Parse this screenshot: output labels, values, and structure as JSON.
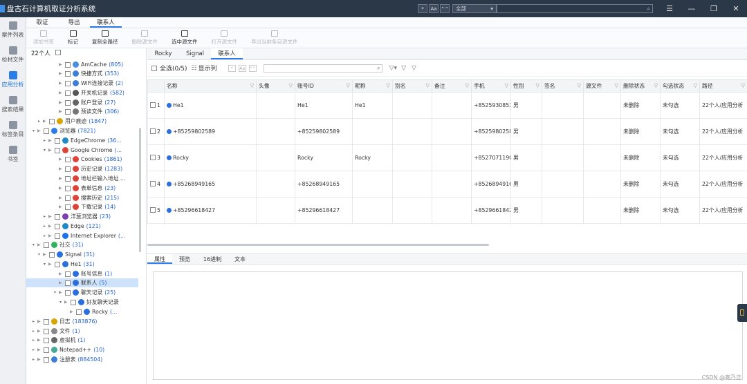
{
  "app": {
    "title": "盘古石计算机取证分析系统"
  },
  "titlebar": {
    "btn1": "*",
    "btn2": "Aa",
    "btn3": "\" \"",
    "scope": "全部",
    "scope_arrow": "▾",
    "search_icon": "⌕",
    "menu": "☰",
    "min": "—",
    "max": "❐",
    "close": "✕"
  },
  "leftnav": [
    {
      "label": "案件列表"
    },
    {
      "label": "检材文件"
    },
    {
      "label": "应用分析"
    },
    {
      "label": "搜索结果"
    },
    {
      "label": "标签条目"
    },
    {
      "label": "书签"
    }
  ],
  "toptabs": [
    "取证",
    "导出",
    "联系人"
  ],
  "toolbar": [
    "添加书签",
    "标记",
    "复制全路径",
    "删除源文件",
    "选中源文件",
    "打开源文件",
    "导出当前条目源文件"
  ],
  "tree": {
    "header": "22个人",
    "rows": [
      {
        "label": "AmCache",
        "count": "(805)"
      },
      {
        "label": "快捷方式",
        "count": "(353)"
      },
      {
        "label": "WiFi连接记录",
        "count": "(2)"
      },
      {
        "label": "开关机记录",
        "count": "(582)"
      },
      {
        "label": "账户登录",
        "count": "(27)"
      },
      {
        "label": "预读文件",
        "count": "(306)"
      },
      {
        "label": "用户痕迹",
        "count": "(1847)"
      },
      {
        "label": "浏览器",
        "count": "(7821)"
      },
      {
        "label": "EdgeChrome",
        "count": "(36..."
      },
      {
        "label": "Google Chrome",
        "count": "(..."
      },
      {
        "label": "Cookies",
        "count": "(1861)"
      },
      {
        "label": "历史记录",
        "count": "(1283)"
      },
      {
        "label": "地址栏输入地址 ...",
        "count": ""
      },
      {
        "label": "表单信息",
        "count": "(23)"
      },
      {
        "label": "搜索历史",
        "count": "(215)"
      },
      {
        "label": "下载记录",
        "count": "(14)"
      },
      {
        "label": "洋葱浏览器",
        "count": "(23)"
      },
      {
        "label": "Edge",
        "count": "(121)"
      },
      {
        "label": "Internet Explorer",
        "count": "(..."
      },
      {
        "label": "社交",
        "count": "(31)"
      },
      {
        "label": "Signal",
        "count": "(31)"
      },
      {
        "label": "He1",
        "count": "(31)"
      },
      {
        "label": "账号信息",
        "count": "(1)"
      },
      {
        "label": "联系人",
        "count": "(5)"
      },
      {
        "label": "聊天记录",
        "count": "(25)"
      },
      {
        "label": "好友聊天记录",
        "count": ""
      },
      {
        "label": "Rocky",
        "count": "(..."
      },
      {
        "label": "日志",
        "count": "(183876)"
      },
      {
        "label": "文件",
        "count": "(1)"
      },
      {
        "label": "虚拟机",
        "count": "(1)"
      },
      {
        "label": "Notepad++",
        "count": "(10)"
      },
      {
        "label": "注册表",
        "count": "(884504)"
      }
    ]
  },
  "subtabs": [
    "Rocky",
    "Signal",
    "联系人"
  ],
  "filter": {
    "select_all": "全选(0/5)",
    "show_cols": "显示列",
    "btn1": "*",
    "btn2": "Aa",
    "btn3": "\" \"",
    "search_icon": "⌕",
    "f1": "▽▾",
    "f2": "▽",
    "f3": "▽"
  },
  "table": {
    "headers": [
      "名称",
      "头像",
      "账号ID",
      "昵称",
      "别名",
      "备注",
      "手机",
      "性别",
      "签名",
      "源文件",
      "删除状态",
      "勾选状态",
      "路径"
    ],
    "rows": [
      {
        "n": "1",
        "name": "He1",
        "avatar": "",
        "id": "He1",
        "nick": "He1",
        "alias": "",
        "note": "",
        "phone": "+85259308538",
        "sex": "男",
        "sign": "",
        "src": "",
        "del": "未删除",
        "chk": "未勾选",
        "path": "22个人/应用分析"
      },
      {
        "n": "2",
        "name": "+85259802589",
        "avatar": "",
        "id": "+85259802589",
        "nick": "",
        "alias": "",
        "note": "",
        "phone": "+85259802589",
        "sex": "男",
        "sign": "",
        "src": "",
        "del": "未删除",
        "chk": "未勾选",
        "path": "22个人/应用分析"
      },
      {
        "n": "3",
        "name": "Rocky",
        "avatar": "",
        "id": "Rocky",
        "nick": "Rocky",
        "alias": "",
        "note": "",
        "phone": "+85270711901",
        "sex": "男",
        "sign": "",
        "src": "",
        "del": "未删除",
        "chk": "未勾选",
        "path": "22个人/应用分析"
      },
      {
        "n": "4",
        "name": "+85268949165",
        "avatar": "",
        "id": "+85268949165",
        "nick": "",
        "alias": "",
        "note": "",
        "phone": "+85268949165",
        "sex": "男",
        "sign": "",
        "src": "",
        "del": "未删除",
        "chk": "未勾选",
        "path": "22个人/应用分析"
      },
      {
        "n": "5",
        "name": "+85296618427",
        "avatar": "",
        "id": "+85296618427",
        "nick": "",
        "alias": "",
        "note": "",
        "phone": "+85296618427",
        "sex": "男",
        "sign": "",
        "src": "",
        "del": "未删除",
        "chk": "未勾选",
        "path": "22个人/应用分析"
      }
    ]
  },
  "bottomtabs": [
    "属性",
    "预览",
    "16进制",
    "文本"
  ],
  "watermark": "CSDN @寄乃正"
}
